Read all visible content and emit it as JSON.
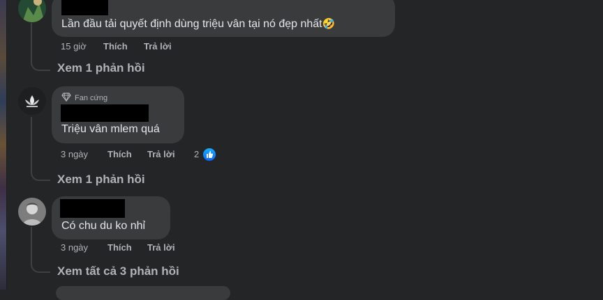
{
  "colors": {
    "background": "#242526",
    "bubble": "#3a3b3c",
    "text": "#e4e6eb",
    "secondary_text": "#b0b3b8",
    "like_blue": "#0866ff"
  },
  "comments": [
    {
      "text": "Lần đầu tải quyết định dùng triệu vân tại nó đẹp nhất",
      "emoji": "🤣",
      "time": "15 giờ",
      "like_label": "Thích",
      "reply_label": "Trả lời",
      "view_replies": "Xem 1 phản hồi"
    },
    {
      "badge": "Fan cứng",
      "badge_icon": "diamond-icon",
      "text": "Triệu vân mlem quá",
      "time": "3 ngày",
      "like_label": "Thích",
      "reply_label": "Trả lời",
      "reaction_count": "2",
      "reaction_icon": "like-icon",
      "view_replies": "Xem 1 phản hồi"
    },
    {
      "text": "Có chu du ko nhỉ",
      "time": "3 ngày",
      "like_label": "Thích",
      "reply_label": "Trả lời",
      "view_replies": "Xem tất cả 3 phản hồi"
    }
  ]
}
